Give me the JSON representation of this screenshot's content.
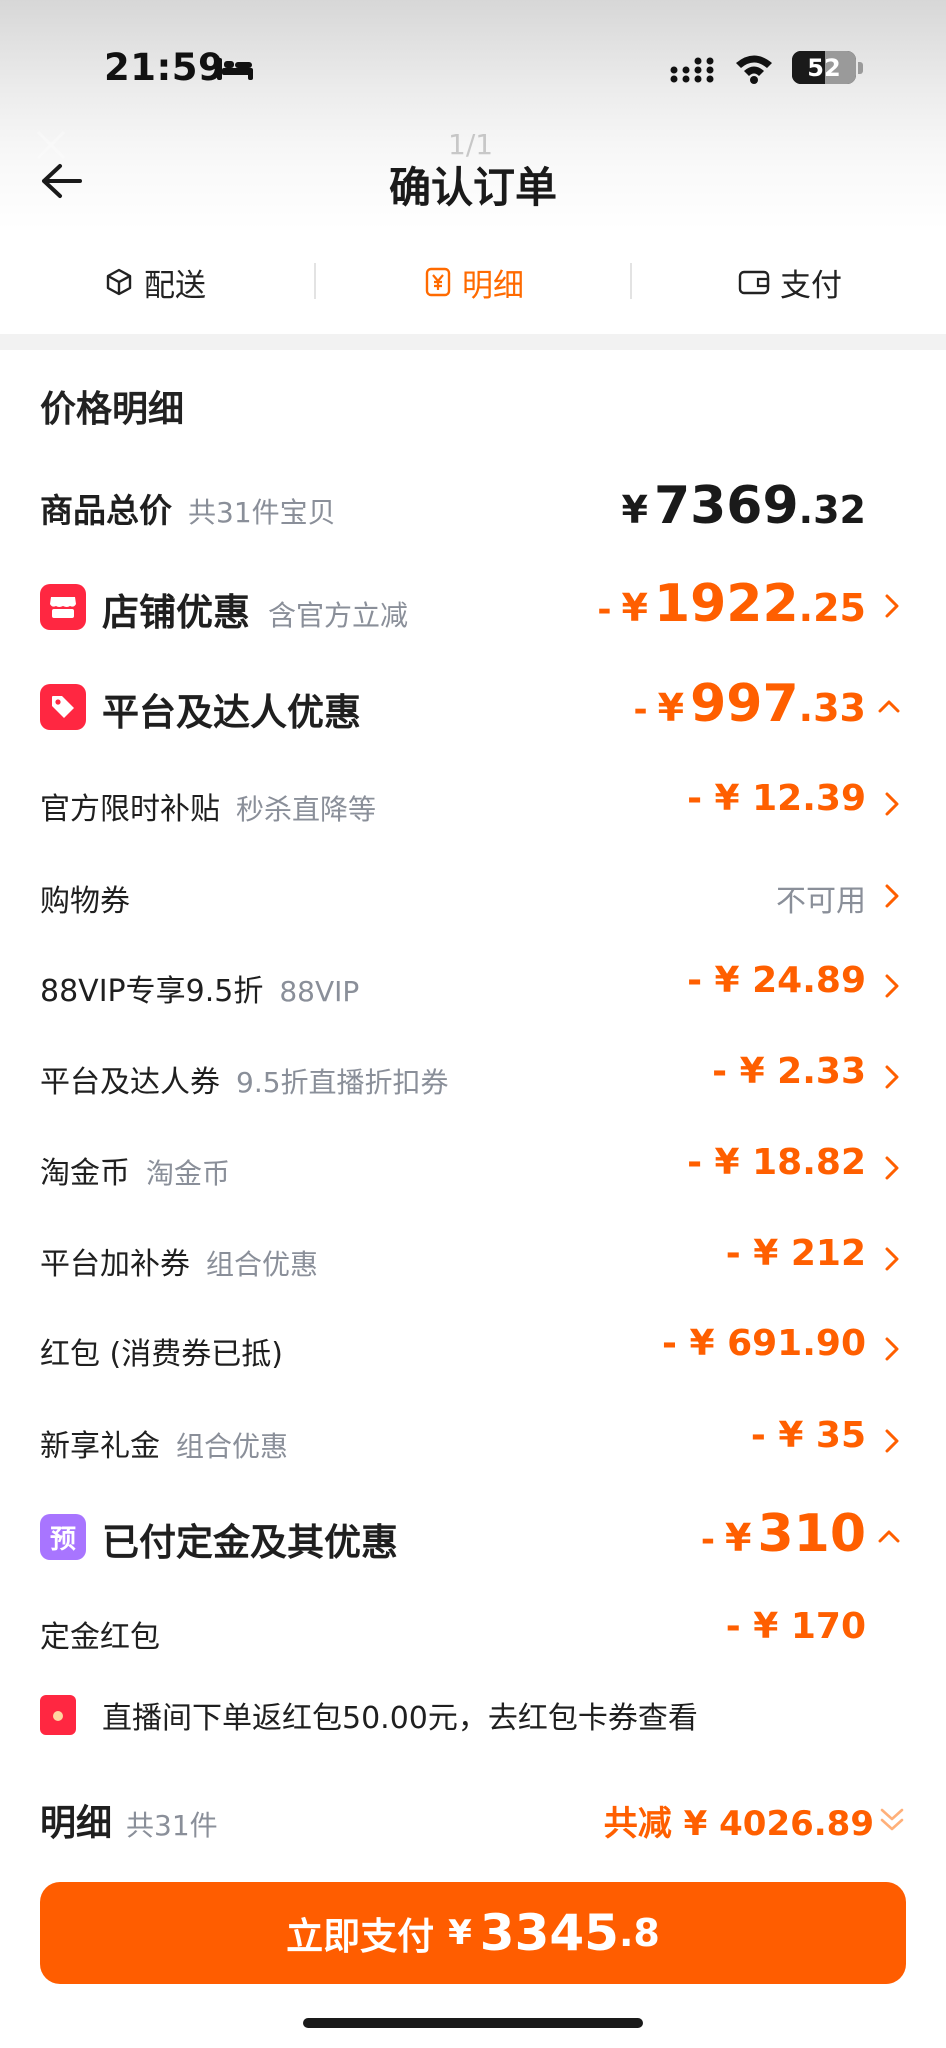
{
  "status_bar": {
    "time": "21:59",
    "battery": "52"
  },
  "header": {
    "title": "确认订单",
    "page_indicator": "1/1"
  },
  "tabs": [
    {
      "label": "配送",
      "icon": "box-icon",
      "active": false
    },
    {
      "label": "明细",
      "icon": "yen-doc-icon",
      "active": true
    },
    {
      "label": "支付",
      "icon": "wallet-icon",
      "active": false
    }
  ],
  "price_detail": {
    "section_title": "价格明细",
    "goods_total": {
      "label": "商品总价",
      "sub": "共31件宝贝",
      "yen": "¥",
      "amount_int": "7369",
      "amount_dec": ".32"
    },
    "store_discount": {
      "label": "店铺优惠",
      "sub": "含官方立减",
      "prefix": "-",
      "yen": "¥",
      "amount_int": "1922",
      "amount_dec": ".25"
    },
    "platform_discount": {
      "label": "平台及达人优惠",
      "prefix": "-",
      "yen": "¥",
      "amount_int": "997",
      "amount_dec": ".33"
    },
    "items": [
      {
        "label": "官方限时补贴",
        "sub": "秒杀直降等",
        "amount": "- ¥ 12.39"
      },
      {
        "label": "购物券",
        "sub": "",
        "amount": "不可用"
      },
      {
        "label": "88VIP专享9.5折",
        "sub": "88VIP",
        "amount": "- ¥ 24.89"
      },
      {
        "label": "平台及达人券",
        "sub": "9.5折直播折扣券",
        "amount": "- ¥ 2.33"
      },
      {
        "label": "淘金币",
        "sub": "淘金币",
        "amount": "- ¥ 18.82"
      },
      {
        "label": "平台加补券",
        "sub": "组合优惠",
        "amount": "- ¥ 212"
      },
      {
        "label": "红包 (消费券已抵)",
        "sub": "",
        "amount": "- ¥ 691.90"
      },
      {
        "label": "新享礼金",
        "sub": "组合优惠",
        "amount": "- ¥ 35"
      }
    ],
    "deposit": {
      "badge": "预",
      "label": "已付定金及其优惠",
      "prefix": "-",
      "yen": "¥",
      "amount": "310"
    },
    "deposit_redpacket": {
      "label": "定金红包",
      "amount": "- ¥ 170"
    },
    "notice": "直播间下单返红包50.00元，去红包卡券查看"
  },
  "summary": {
    "title": "明细",
    "count": "共31件",
    "total_reduce": "共减 ¥ 4026.89"
  },
  "pay_button": {
    "label": "立即支付",
    "yen": "¥",
    "amount_int": "3345",
    "amount_dec": ".8"
  },
  "colors": {
    "accent": "#ff5f00",
    "badge_red": "#ff2741",
    "badge_purple": "#a875ff"
  }
}
